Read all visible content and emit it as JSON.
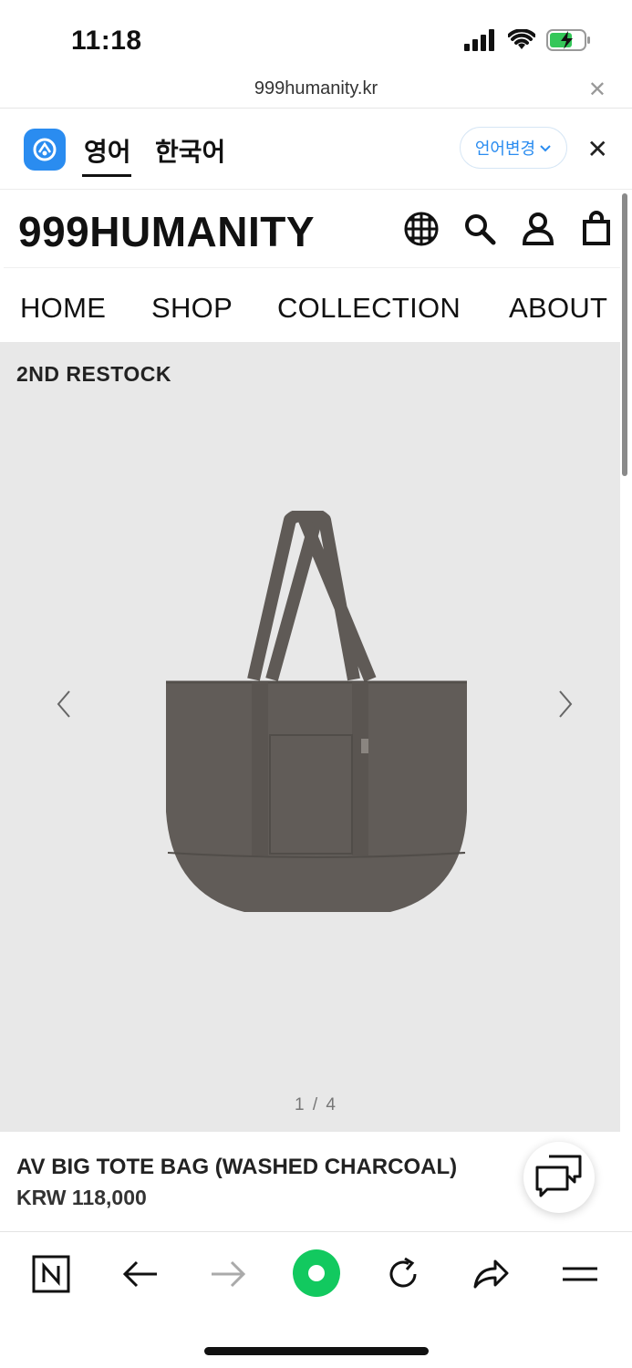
{
  "status_bar": {
    "time": "11:18",
    "battery_state": "charging"
  },
  "browser": {
    "url": "999humanity.kr"
  },
  "translate_bar": {
    "source_lang": "영어",
    "target_lang": "한국어",
    "change_language_label": "언어변경",
    "accent_color": "#2a8cf0"
  },
  "site": {
    "brand": "999HUMANITY",
    "header_icons": [
      "globe-icon",
      "search-icon",
      "account-icon",
      "cart-icon"
    ],
    "nav": [
      "HOME",
      "SHOP",
      "COLLECTION",
      "ABOUT"
    ]
  },
  "product": {
    "badge": "2ND RESTOCK",
    "image_counter": "1 / 4",
    "name": "AV BIG TOTE BAG (WASHED CHARCOAL)",
    "price": "KRW 118,000"
  },
  "toolbar": {
    "icons": [
      "naver-icon",
      "back-arrow-icon",
      "forward-arrow-icon",
      "green-dot-home-icon",
      "reload-icon",
      "share-icon",
      "menu-icon"
    ],
    "green_color": "#12c95f"
  }
}
